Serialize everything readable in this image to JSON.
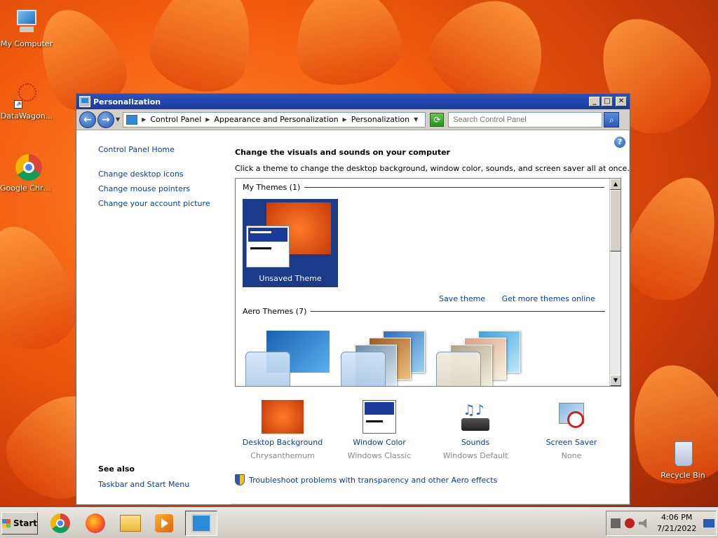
{
  "desktop": {
    "icons": [
      {
        "label": "My Computer"
      },
      {
        "label": "DataWagon..."
      },
      {
        "label": "Google Chrome"
      },
      {
        "label": "Recycle Bin"
      }
    ]
  },
  "window": {
    "title": "Personalization",
    "controls": {
      "minimize": "_",
      "maximize": "□",
      "close": "✕"
    }
  },
  "address": {
    "crumbs": [
      "Control Panel",
      "Appearance and Personalization",
      "Personalization"
    ],
    "search_placeholder": "Search Control Panel"
  },
  "left_pane": {
    "home": "Control Panel Home",
    "links": [
      "Change desktop icons",
      "Change mouse pointers",
      "Change your account picture"
    ],
    "see_also_title": "See also",
    "see_also_links": [
      "Taskbar and Start Menu"
    ]
  },
  "main": {
    "heading": "Change the visuals and sounds on your computer",
    "subheading": "Click a theme to change the desktop background, window color, sounds, and screen saver all at once.",
    "my_themes_title": "My Themes (1)",
    "my_theme_name": "Unsaved Theme",
    "save_theme": "Save theme",
    "more_themes": "Get more themes online",
    "aero_themes_title": "Aero Themes (7)",
    "bottom": [
      {
        "label": "Desktop Background",
        "sub": "Chrysanthemum"
      },
      {
        "label": "Window Color",
        "sub": "Windows Classic"
      },
      {
        "label": "Sounds",
        "sub": "Windows Default"
      },
      {
        "label": "Screen Saver",
        "sub": "None"
      }
    ],
    "troubleshoot": "Troubleshoot problems with transparency and other Aero effects"
  },
  "taskbar": {
    "start_label": "Start",
    "time": "4:06 PM",
    "date": "7/21/2022"
  },
  "colors": {
    "accent": "#1b3a9a",
    "link": "#0b3c9c",
    "desktop": "#f25d0e"
  }
}
